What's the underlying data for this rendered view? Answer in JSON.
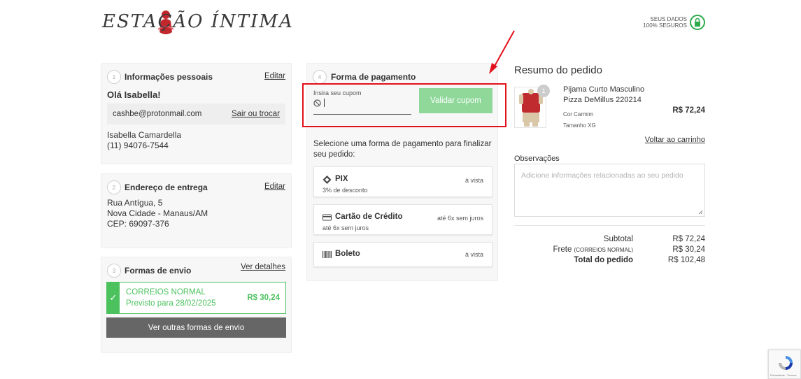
{
  "header": {
    "logo_text": "ESTAÇÃO ÍNTIMA",
    "secure_line1": "SEUS DADOS",
    "secure_line2": "100% SEGUROS"
  },
  "personal": {
    "step": "1",
    "title": "Informações pessoais",
    "edit_label": "Editar",
    "greeting": "Olá Isabella!",
    "email": "cashbe@protonmail.com",
    "switch_label": "Sair ou trocar",
    "name": "Isabella Camardella",
    "phone": "(11) 94076-7544"
  },
  "address": {
    "step": "2",
    "title": "Endereço de entrega",
    "edit_label": "Editar",
    "line1": "Rua Antígua, 5",
    "line2": "Nova Cidade - Manaus/AM",
    "line3": "CEP: 69097-376"
  },
  "shipping": {
    "step": "3",
    "title": "Formas de envio",
    "details_label": "Ver detalhes",
    "option_name": "CORREIOS NORMAL",
    "option_date": "Previsto para 28/02/2025",
    "option_price": "R$ 30,24",
    "other_button": "Ver outras formas de envio"
  },
  "payment": {
    "step": "4",
    "title": "Forma de pagamento",
    "coupon_label": "Insira seu cupom",
    "coupon_button": "Validar cupom",
    "instructions": "Selecione uma forma de pagamento para finalizar seu pedido:",
    "options": [
      {
        "name": "PIX",
        "sub": "3% de desconto",
        "right": "à vista",
        "icon": "pix-icon"
      },
      {
        "name": "Cartão de Crédito",
        "sub": "até 6x sem juros",
        "right": "até 6x sem juros",
        "icon": "credit-card-icon"
      },
      {
        "name": "Boleto",
        "sub": "",
        "right": "à vista",
        "icon": "barcode-icon"
      }
    ]
  },
  "summary": {
    "title": "Resumo do pedido",
    "product_qty": "1",
    "product_name_line1": "Pijama Curto Masculino",
    "product_name_line2": "Pizza DeMillus 220214",
    "product_color": "Cor Carmim",
    "product_size": "Tamanho XG",
    "product_price": "R$ 72,24",
    "back_label": "Voltar ao carrinho",
    "notes_label": "Observações",
    "notes_placeholder": "Adicione informações relacionadas ao seu pedido",
    "subtotal_label": "Subtotal",
    "subtotal_value": "R$ 72,24",
    "freight_label": "Frete",
    "freight_method": "(CORREIOS NORMAL)",
    "freight_value": "R$ 30,24",
    "total_label": "Total do pedido",
    "total_value": "R$ 102,48"
  },
  "recaptcha": {
    "text": "Privacidade - Termos"
  },
  "colors": {
    "success": "#4cc25e",
    "coupon_button": "#8fd89a",
    "annotation": "#e3111b",
    "dark_button": "#666666"
  }
}
